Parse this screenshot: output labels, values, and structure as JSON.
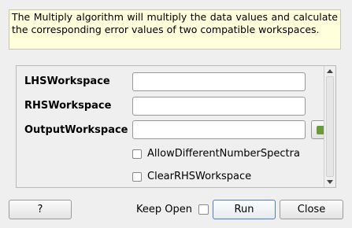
{
  "description": "The Multiply algorithm will multiply the data values and calculate the corresponding error values of two compatible workspaces.",
  "properties": {
    "lhs_label": "LHSWorkspace",
    "rhs_label": "RHSWorkspace",
    "output_label": "OutputWorkspace",
    "lhs_value": "",
    "rhs_value": "",
    "output_value": "",
    "allow_diff_label": "AllowDifferentNumberSpectra",
    "clear_rhs_label": "ClearRHSWorkspace"
  },
  "footer": {
    "help_label": "?",
    "keep_open_label": "Keep Open",
    "run_label": "Run",
    "close_label": "Close"
  },
  "colors": {
    "description_bg": "#ffffdc",
    "default_button_border": "#4a7ecf"
  }
}
